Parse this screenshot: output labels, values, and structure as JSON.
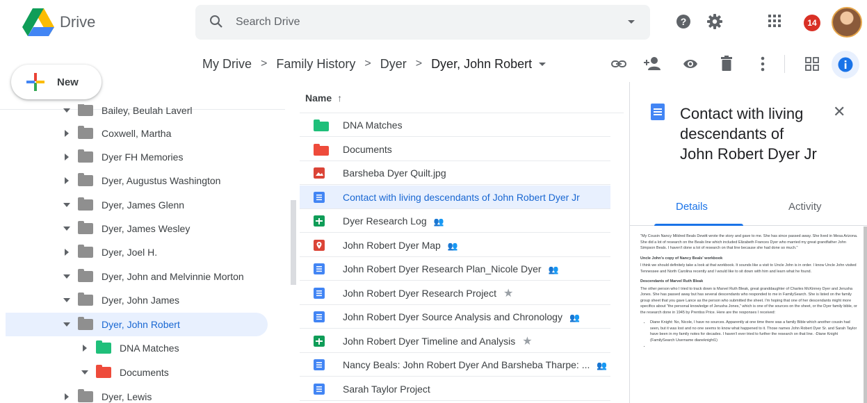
{
  "topbar": {
    "app_name": "Drive",
    "search_placeholder": "Search Drive",
    "notifications_count": "14",
    "icons": [
      "drive-logo-icon",
      "search-icon",
      "help-icon",
      "gear-icon",
      "apps-grid-icon",
      "avatar"
    ]
  },
  "new_button": {
    "label": "New"
  },
  "breadcrumb": [
    "My Drive",
    "Family History",
    "Dyer",
    "Dyer, John Robert"
  ],
  "sidebar_tree": [
    {
      "label": "Bailey, Beulah Laverl",
      "expanded": true,
      "color": "#8f8f8f"
    },
    {
      "label": "Coxwell, Martha",
      "expanded": false,
      "color": "#8f8f8f"
    },
    {
      "label": "Dyer FH Memories",
      "expanded": false,
      "color": "#8f8f8f"
    },
    {
      "label": "Dyer, Augustus Washington",
      "expanded": false,
      "color": "#8f8f8f"
    },
    {
      "label": "Dyer, James Glenn",
      "expanded": true,
      "color": "#8f8f8f"
    },
    {
      "label": "Dyer, James Wesley",
      "expanded": true,
      "color": "#8f8f8f"
    },
    {
      "label": "Dyer, Joel H.",
      "expanded": false,
      "color": "#8f8f8f"
    },
    {
      "label": "Dyer, John and Melvinnie Morton",
      "expanded": true,
      "color": "#8f8f8f"
    },
    {
      "label": "Dyer, John James",
      "expanded": true,
      "color": "#8f8f8f"
    },
    {
      "label": "Dyer, John Robert",
      "expanded": true,
      "selected": true,
      "color": "#8f8f8f"
    },
    {
      "label": "DNA Matches",
      "expanded": false,
      "indent": true,
      "color": "#1fbf7a"
    },
    {
      "label": "Documents",
      "expanded": true,
      "indent": true,
      "color": "#ee4b3b"
    },
    {
      "label": "Dyer, Lewis",
      "expanded": false,
      "color": "#8f8f8f"
    }
  ],
  "file_list": {
    "column_header": "Name",
    "sort_arrow": "↑",
    "items": [
      {
        "name": "DNA Matches",
        "type": "folder",
        "color": "#1fbf7a"
      },
      {
        "name": "Documents",
        "type": "folder",
        "color": "#ee4b3b"
      },
      {
        "name": "Barsheba Dyer Quilt.jpg",
        "type": "image",
        "color": "#db4437"
      },
      {
        "name": "Contact with living descendants of John Robert Dyer Jr",
        "type": "doc",
        "color": "#4285f4",
        "selected": true
      },
      {
        "name": "Dyer Research Log",
        "type": "sheet",
        "color": "#0f9d58",
        "shared": true
      },
      {
        "name": "John Robert Dyer Map",
        "type": "map",
        "color": "#db4437",
        "shared": true
      },
      {
        "name": "John Robert Dyer Research Plan_Nicole Dyer",
        "type": "doc",
        "color": "#4285f4",
        "shared": true
      },
      {
        "name": "John Robert Dyer Research Project",
        "type": "doc",
        "color": "#4285f4",
        "starred": true
      },
      {
        "name": "John Robert Dyer Source Analysis and Chronology",
        "type": "doc",
        "color": "#4285f4",
        "shared": true
      },
      {
        "name": "John Robert Dyer Timeline and Analysis",
        "type": "sheet",
        "color": "#0f9d58",
        "starred": true
      },
      {
        "name": "Nancy Beals: John Robert Dyer And Barsheba Tharpe: ...",
        "type": "doc",
        "color": "#4285f4",
        "shared": true
      },
      {
        "name": "Sarah Taylor Project",
        "type": "doc",
        "color": "#4285f4"
      }
    ]
  },
  "details": {
    "title": "Contact with living descendants of John Robert Dyer Jr",
    "tab_details": "Details",
    "tab_activity": "Activity",
    "preview": {
      "p1": "\"My Cousin Nancy Mildred Beals Dewitt wrote the story and gave to me. She has since passed away. She lived in Mesa Arizona. She did a lot of research on the Beals line which included Elizabeth Frances Dyer who married my great grandfather John Simpson Beals. I haven't done a lot of research on that line because she had done so much.\"",
      "h2": "Uncle John's copy of Nancy Beals' workbook",
      "p2": "I think we should definitely take a look at that workbook. It sounds like a visit to Uncle John is in order. I know Uncle John visited Tennessee and North Carolina recently and I would like to sit down with him and learn what he found.",
      "h3": "Descendants of Marvel Ruth Bleak",
      "p3": "The other person who I tried to track down is Marvel Ruth Bleak, great granddaughter of Charles McKinney Dyer and Jerusha Jones. She has passed away but has several descendants who responded to me in FamilySearch. She is listed on the family group sheet that you gave Lance as the person who submitted the sheet. I'm hoping that one of her descendants might more specifics about \"the personal knowledge of Jerusha Jones,\" which is one of the sources on the sheet, or the Dyer family bible, or the research done in 1945 by Prentiss Price. Here are the responses I received:",
      "li1": "Diane Knight: No, Nicole, I have no sources. Apparently at one time there was a family Bible which another cousin had seen, but it was lost and no one seems to know what happened to it. Those names John Robert Dyer Sr. and Sarah Taylor have been in my family notes for decades. I haven't ever tried to further the research on that line. -Diane Knight (FamilySearch Username dianeknight1)"
    }
  }
}
